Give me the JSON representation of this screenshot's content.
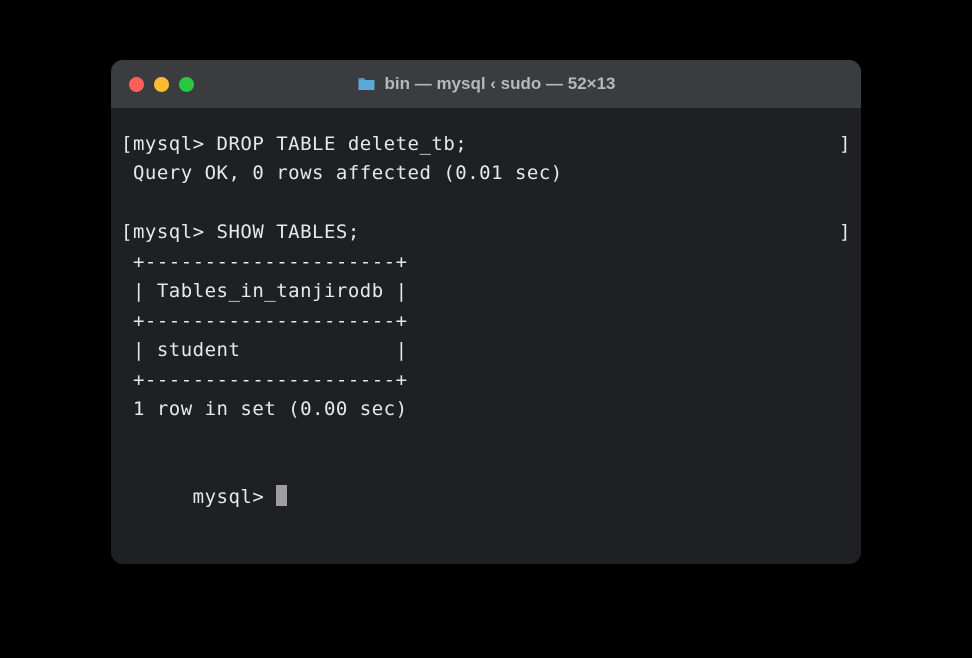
{
  "titlebar": {
    "title": "bin — mysql ‹ sudo — 52×13"
  },
  "terminal": {
    "line1_left": "[mysql> DROP TABLE delete_tb;",
    "line1_right": "]",
    "line2": " Query OK, 0 rows affected (0.01 sec)",
    "line3_left": "[mysql> SHOW TABLES;",
    "line3_right": "]",
    "line4": " +---------------------+",
    "line5": " | Tables_in_tanjirodb |",
    "line6": " +---------------------+",
    "line7": " | student             |",
    "line8": " +---------------------+",
    "line9": " 1 row in set (0.00 sec)",
    "line10": "mysql> "
  }
}
